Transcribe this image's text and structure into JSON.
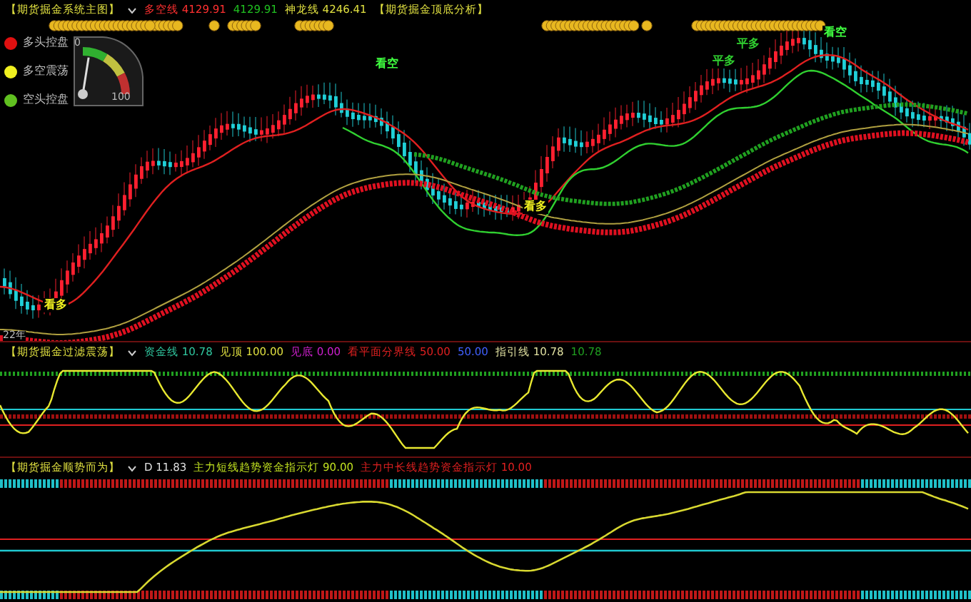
{
  "main_panel": {
    "title": "【期货掘金系统主图】",
    "readouts": [
      {
        "text": "多空线 4129.91",
        "color": "#ff3030"
      },
      {
        "text": "4129.91",
        "color": "#20c020"
      },
      {
        "text": "神龙线 4246.41",
        "color": "#e0e040"
      }
    ],
    "link": "【期货掘金顶底分析】",
    "legend": [
      {
        "label": "多头控盘",
        "color": "#e01010"
      },
      {
        "label": "多空震荡",
        "color": "#f0f020"
      },
      {
        "label": "空头控盘",
        "color": "#60c020"
      }
    ],
    "gauge": {
      "min_label": "0",
      "max_label": "100",
      "level": 0.1
    },
    "signals": [
      {
        "text": "平多",
        "kind": "close"
      },
      {
        "text": "看空",
        "kind": "sell"
      },
      {
        "text": "平多",
        "kind": "close"
      },
      {
        "text": "看空",
        "kind": "sell"
      },
      {
        "text": "看多",
        "kind": "buy"
      },
      {
        "text": "看多",
        "kind": "buy"
      }
    ],
    "footer": "22年"
  },
  "filter_panel": {
    "title": "【期货掘金过滤震荡】",
    "readouts": [
      {
        "text": "资金线 10.78",
        "color": "#30c8a0"
      },
      {
        "text": "见顶 100.00",
        "color": "#e0e040"
      },
      {
        "text": "见底 0.00",
        "color": "#d020d0"
      },
      {
        "text": "看平面分界线 50.00",
        "color": "#e02020"
      },
      {
        "text": "50.00",
        "color": "#4060ff"
      },
      {
        "text": "指引线 10.78",
        "color": "#e0e0a0"
      },
      {
        "text": "10.78",
        "color": "#20a020"
      }
    ]
  },
  "trend_panel": {
    "title": "【期货掘金顺势而为】",
    "readouts": [
      {
        "text": "D 11.83",
        "color": "#e0e0e0"
      },
      {
        "text": "主力短线趋势资金指示灯 90.00",
        "color": "#c0e020"
      },
      {
        "text": "主力中长线趋势资金指示灯 10.00",
        "color": "#e02020"
      }
    ]
  }
}
